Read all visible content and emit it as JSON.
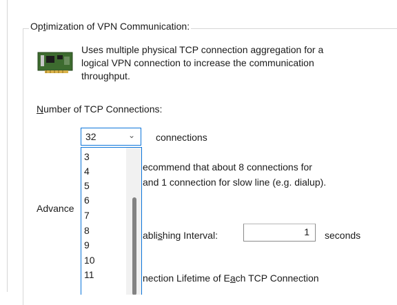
{
  "group": {
    "title_pre": "Op",
    "title_ul": "t",
    "title_post": "imization of VPN Communication:"
  },
  "description": [
    "Uses multiple physical TCP connection aggregation for a",
    "logical VPN connection to increase the communication",
    "throughput."
  ],
  "num_connections": {
    "label_ul": "N",
    "label_post": "umber of TCP Connections:",
    "selected_value": "32",
    "suffix": "connections"
  },
  "dropdown_options": [
    "3",
    "4",
    "5",
    "6",
    "7",
    "8",
    "9",
    "10",
    "11"
  ],
  "recommendation": [
    "ecommend that about 8 connections for",
    " and 1 connection for slow line (e.g. dialup)."
  ],
  "advanced_label": "Advance",
  "interval": {
    "label_pre": "abli",
    "label_ul": "s",
    "label_post": "hing Interval:",
    "value": "1",
    "suffix": "seconds"
  },
  "lifetime": {
    "label_pre": "nection Lifetime of E",
    "label_ul": "a",
    "label_post": "ch TCP Connection"
  },
  "icons": {
    "nic": "network-card-icon",
    "combo_arrow": "chevron-down-icon"
  },
  "colors": {
    "focus_border": "#0a74da",
    "scroll_thumb": "#838383"
  }
}
